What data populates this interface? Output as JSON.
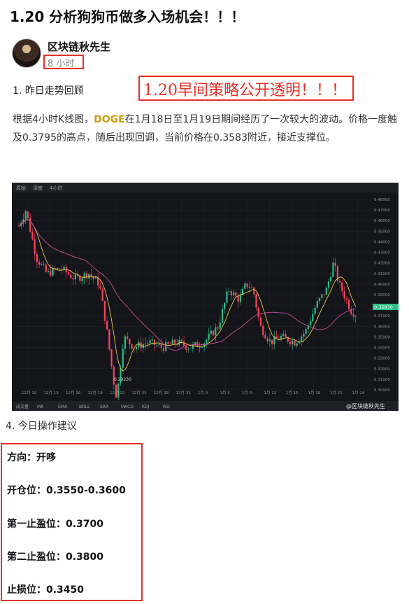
{
  "post": {
    "title": "1.20 分析狗狗币做多入场机会！！！",
    "author": "区块链秋先生",
    "time": "8 小时",
    "promo": "1.20早间策略公开透明！！！",
    "section1_heading": "1. 昨日走势回顾",
    "para_prefix": "根据4小时K线图，",
    "para_coin": "DOGE",
    "para_rest": "在1月18日至1月19日期间经历了一次较大的波动。价格一度触及0.3795的高点，随后出现回调，当前价格在0.3583附近，接近支撑位。",
    "section4_heading": "4. 今日操作建议",
    "ops": [
      "方向：开哆",
      "开仓位：0.3550-0.3600",
      "第一止盈位：0.3700",
      "第二止盈位：0.3800",
      "止损位：0.3450"
    ]
  },
  "chart": {
    "toolbar": [
      "原始",
      "深度",
      "4小时"
    ],
    "price_labels": [
      "0.48000",
      "0.47000",
      "0.46000",
      "0.45000",
      "0.44000",
      "0.43000",
      "0.42000",
      "0.41000",
      "0.40000",
      "0.39000",
      "0.38000",
      "0.37000",
      "0.36000",
      "0.35000",
      "0.34000",
      "0.33000",
      "0.32000",
      "0.31000",
      "0.30000"
    ],
    "current_price": "0.35830",
    "low_label": "0.29230",
    "date_labels": [
      "12月 10",
      "12月 13",
      "12月 16",
      "12月 19",
      "12月 22",
      "12月 25",
      "12月 28",
      "12月 31",
      "1月 3",
      "1月 6",
      "1月 9",
      "1月 12",
      "1月 15",
      "1月 18",
      "1月 21",
      "1月 24"
    ],
    "bottom_tools": [
      "成交量",
      "MA",
      "EMA",
      "BOLL",
      "SAR",
      "MACD",
      "KDJ",
      "RSI"
    ],
    "watermark": "@区块链秋先生",
    "colors": {
      "up": "#2ebd85",
      "down": "#f6465d",
      "ma_yellow": "#e8c547",
      "ma_pink": "#c94b9a",
      "price_tag": "#2ebd85"
    }
  }
}
